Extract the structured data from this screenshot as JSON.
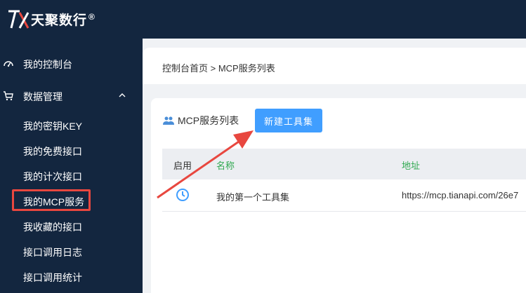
{
  "brand": {
    "name": "天聚数行",
    "reg": "®"
  },
  "sidebar": {
    "items": [
      {
        "label": "我的控制台",
        "icon": "dashboard-icon"
      },
      {
        "label": "数据管理",
        "icon": "cart-icon",
        "expanded": true
      }
    ],
    "subitems": [
      {
        "label": "我的密钥KEY"
      },
      {
        "label": "我的免费接口"
      },
      {
        "label": "我的计次接口"
      },
      {
        "label": "我的MCP服务",
        "active": true
      },
      {
        "label": "我收藏的接口"
      },
      {
        "label": "接口调用日志"
      },
      {
        "label": "接口调用统计"
      }
    ]
  },
  "breadcrumb": {
    "text": "控制台首页 > MCP服务列表"
  },
  "section": {
    "title": "MCP服务列表",
    "new_button": "新建工具集"
  },
  "table": {
    "headers": [
      "启用",
      "名称",
      "地址"
    ],
    "rows": [
      {
        "enabled_icon": "clock-icon",
        "name": "我的第一个工具集",
        "address": "https://mcp.tianapi.com/26e7"
      }
    ]
  },
  "colors": {
    "sidebar_bg": "#13263f",
    "accent_blue": "#409eff",
    "highlight_red": "#e8473f",
    "header_green": "#2ea84f"
  }
}
